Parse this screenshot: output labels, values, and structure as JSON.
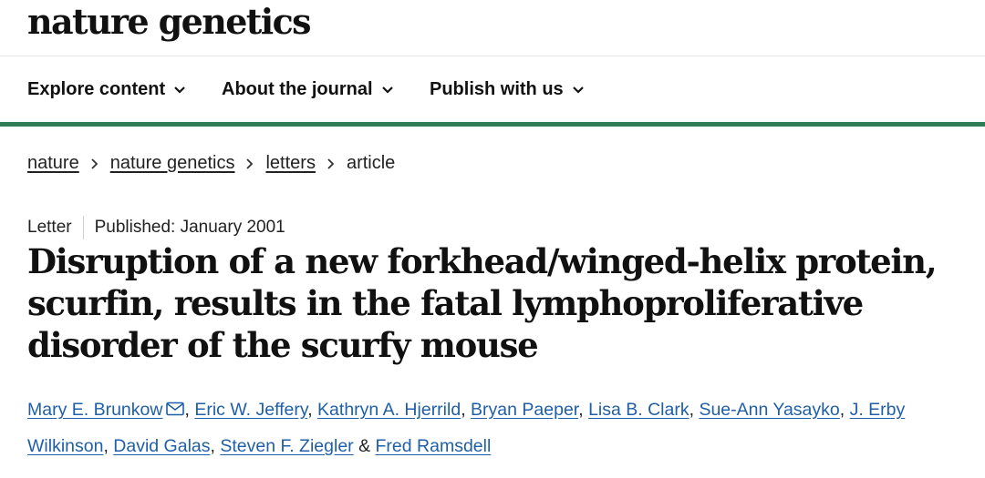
{
  "site": {
    "logo": "nature genetics"
  },
  "nav": {
    "items": [
      {
        "label": "Explore content",
        "icon": "chevron-down-icon"
      },
      {
        "label": "About the journal",
        "icon": "chevron-down-icon"
      },
      {
        "label": "Publish with us",
        "icon": "chevron-down-icon"
      }
    ]
  },
  "breadcrumb": {
    "items": [
      "nature",
      "nature genetics",
      "letters"
    ],
    "current": "article"
  },
  "article": {
    "type": "Letter",
    "published": "Published: January 2001",
    "title": "Disruption of a new forkhead/winged-helix protein, scurfin, results in the fatal lymphoproliferative disorder of the scurfy mouse",
    "authors": [
      "Mary E. Brunkow",
      "Eric W. Jeffery",
      "Kathryn A. Hjerrild",
      "Bryan Paeper",
      "Lisa B. Clark",
      "Sue-Ann Yasayko",
      "J. Erby Wilkinson",
      "David Galas",
      "Steven F. Ziegler",
      "Fred Ramsdell"
    ],
    "separator": ", ",
    "last_separator": " & "
  },
  "colors": {
    "accent_rule": "#2e7d55",
    "link": "#1f5fa8"
  }
}
